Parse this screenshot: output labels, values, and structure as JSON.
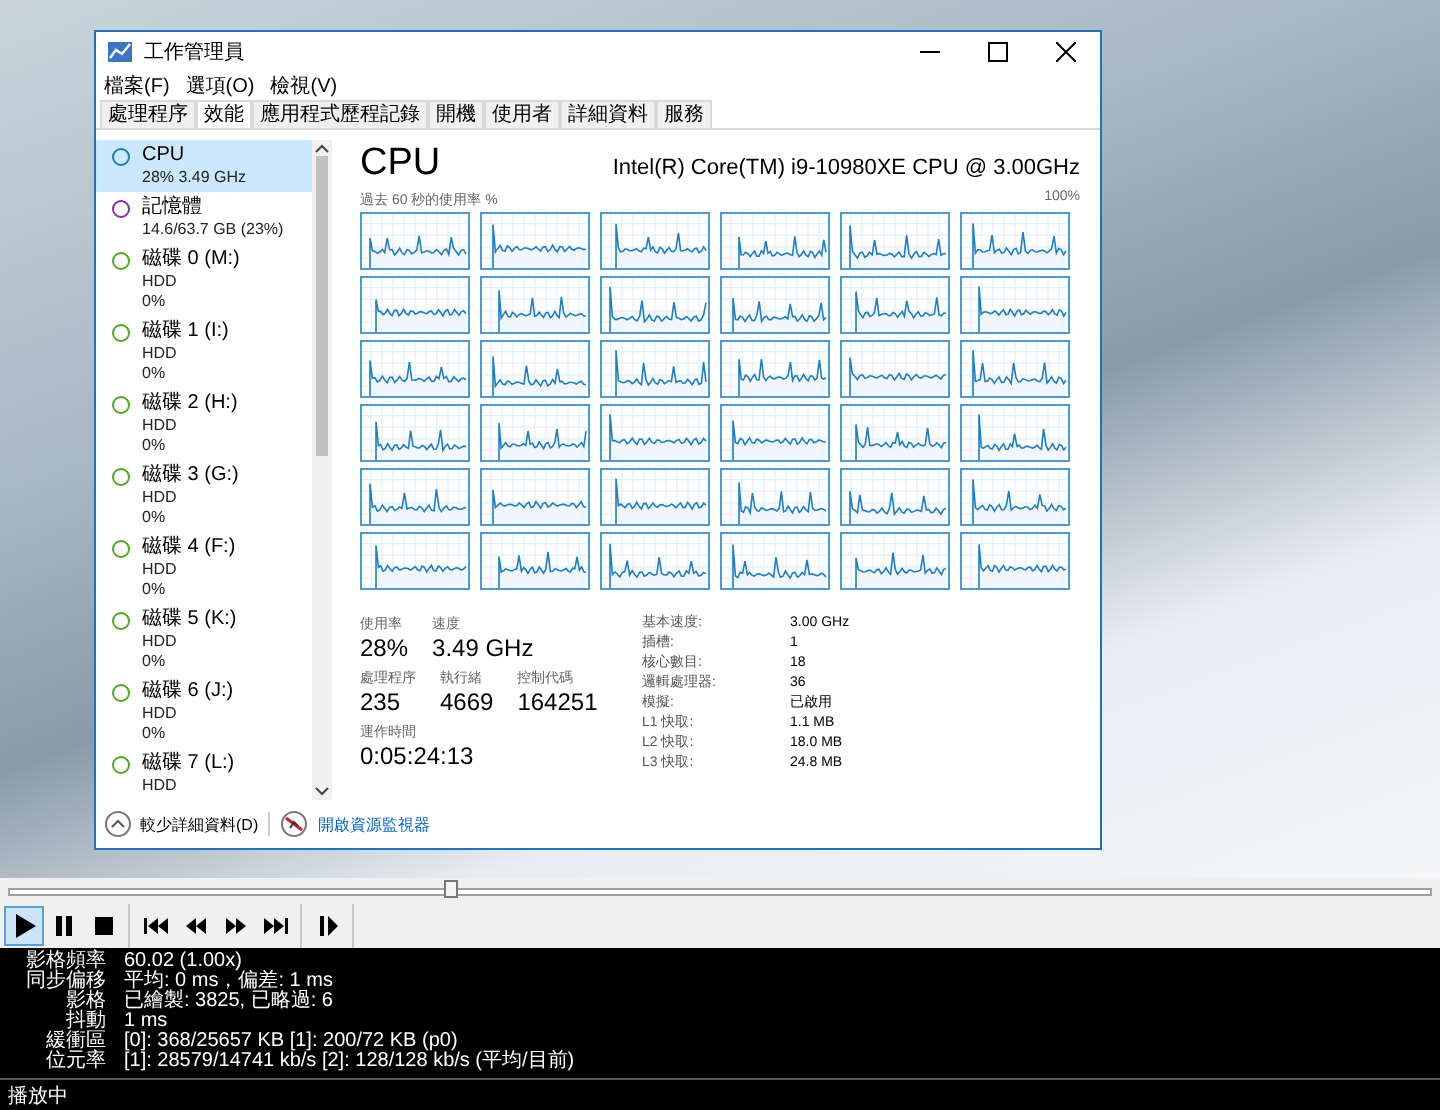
{
  "video": {
    "task_manager": {
      "title": "工作管理員",
      "menu": [
        "檔案(F)",
        "選項(O)",
        "檢視(V)"
      ],
      "tabs": [
        {
          "label": "處理程序",
          "selected": false
        },
        {
          "label": "效能",
          "selected": true
        },
        {
          "label": "應用程式歷程記錄",
          "selected": false
        },
        {
          "label": "開機",
          "selected": false
        },
        {
          "label": "使用者",
          "selected": false
        },
        {
          "label": "詳細資料",
          "selected": false
        },
        {
          "label": "服務",
          "selected": false
        }
      ],
      "sidebar": {
        "items": [
          {
            "name": "CPU",
            "details": [
              "28% 3.49 GHz"
            ],
            "color": "#1c7ec0",
            "selected": true
          },
          {
            "name": "記憶體",
            "details": [
              "14.6/63.7 GB (23%)"
            ],
            "color": "#8b2ab0",
            "selected": false
          },
          {
            "name": "磁碟 0 (M:)",
            "details": [
              "HDD",
              "0%"
            ],
            "color": "#4da81c",
            "selected": false
          },
          {
            "name": "磁碟 1 (I:)",
            "details": [
              "HDD",
              "0%"
            ],
            "color": "#4da81c",
            "selected": false
          },
          {
            "name": "磁碟 2 (H:)",
            "details": [
              "HDD",
              "0%"
            ],
            "color": "#4da81c",
            "selected": false
          },
          {
            "name": "磁碟 3 (G:)",
            "details": [
              "HDD",
              "0%"
            ],
            "color": "#4da81c",
            "selected": false
          },
          {
            "name": "磁碟 4 (F:)",
            "details": [
              "HDD",
              "0%"
            ],
            "color": "#4da81c",
            "selected": false
          },
          {
            "name": "磁碟 5 (K:)",
            "details": [
              "HDD",
              "0%"
            ],
            "color": "#4da81c",
            "selected": false
          },
          {
            "name": "磁碟 6 (J:)",
            "details": [
              "HDD",
              "0%"
            ],
            "color": "#4da81c",
            "selected": false
          },
          {
            "name": "磁碟 7 (L:)",
            "details": [
              "HDD"
            ],
            "color": "#4da81c",
            "selected": false
          }
        ]
      },
      "panel": {
        "title": "CPU",
        "model": "Intel(R) Core(TM) i9-10980XE CPU @ 3.00GHz",
        "graph_caption": "過去 60 秒的使用率 %",
        "graph_max": "100%",
        "stat_rows": [
          [
            {
              "label": "使用率",
              "value": "28%"
            },
            {
              "label": "速度",
              "value": "3.49 GHz"
            }
          ],
          [
            {
              "label": "處理程序",
              "value": "235"
            },
            {
              "label": "執行緒",
              "value": "4669"
            },
            {
              "label": "控制代碼",
              "value": "164251"
            }
          ],
          [
            {
              "label": "運作時間",
              "value": "0:05:24:13"
            }
          ]
        ],
        "specs": [
          {
            "label": "基本速度:",
            "value": "3.00 GHz"
          },
          {
            "label": "插槽:",
            "value": "1"
          },
          {
            "label": "核心數目:",
            "value": "18"
          },
          {
            "label": "邏輯處理器:",
            "value": "36"
          },
          {
            "label": "模擬:",
            "value": "已啟用"
          },
          {
            "label": "L1 快取:",
            "value": "1.1 MB"
          },
          {
            "label": "L2 快取:",
            "value": "18.0 MB"
          },
          {
            "label": "L3 快取:",
            "value": "24.8 MB"
          }
        ]
      },
      "footer": {
        "fewer_details": "較少詳細資料(D)",
        "resource_monitor_link": "開啟資源監視器"
      }
    }
  },
  "seek_bar": {
    "level": 0.31
  },
  "control_groups": [
    [
      {
        "kind": "play",
        "selected": true
      },
      {
        "kind": "pause",
        "selected": false
      },
      {
        "kind": "stop",
        "selected": false
      }
    ],
    [
      {
        "kind": "skip-back",
        "selected": false
      },
      {
        "kind": "rewind",
        "selected": false
      },
      {
        "kind": "fast-forward",
        "selected": false
      },
      {
        "kind": "skip-forward",
        "selected": false
      }
    ],
    [
      {
        "kind": "frame-step",
        "selected": false
      }
    ]
  ],
  "stats": [
    {
      "label": "影格頻率",
      "value": "60.02 (1.00x)"
    },
    {
      "label": "同步偏移",
      "value": "平均: 0 ms，偏差: 1 ms"
    },
    {
      "label": "影格",
      "value": "已繪製: 3825, 已略過: 6"
    },
    {
      "label": "抖動",
      "value": "1 ms"
    },
    {
      "label": "緩衝區",
      "value": "[0]: 368/25657 KB [1]: 200/72 KB (p0)"
    },
    {
      "label": "位元率",
      "value": "[1]: 28579/14741 kb/s [2]: 128/128 kb/s (平均/目前)"
    }
  ],
  "status_bar": "播放中"
}
